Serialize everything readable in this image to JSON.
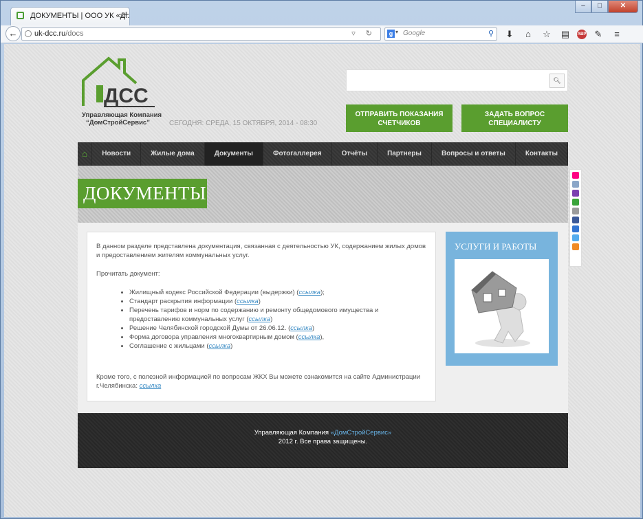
{
  "browser": {
    "tab_title": "ДОКУМЕНТЫ | ООО УК «Д...",
    "new_tab": "+",
    "url_host": "uk-dcc.ru",
    "url_path": "/docs",
    "search_engine": "g",
    "search_placeholder": "Google",
    "window_buttons": {
      "minimize": "–",
      "maximize": "□",
      "close": "✕"
    }
  },
  "header": {
    "logo_text": "ДСС",
    "logo_caption_1": "Управляющая Компания",
    "logo_caption_2": "“ДомСтройСервис”",
    "date_text": "СЕГОДНЯ: СРЕДА, 15 ОКТЯБРЯ, 2014 - 08:30",
    "search_value": "",
    "buttons": [
      {
        "label": "ОТПРАВИТЬ ПОКАЗАНИЯ СЧЕТЧИКОВ"
      },
      {
        "label": "ЗАДАТЬ ВОПРОС СПЕЦИАЛИСТУ"
      }
    ]
  },
  "menu": {
    "home_icon": "home-icon",
    "items": [
      {
        "label": "Новости"
      },
      {
        "label": "Жилые дома"
      },
      {
        "label": "Документы"
      },
      {
        "label": "Фотогаллерея"
      },
      {
        "label": "Отчёты"
      },
      {
        "label": "Партнеры"
      },
      {
        "label": "Вопросы и ответы"
      },
      {
        "label": "Контакты"
      }
    ],
    "active_index": 2
  },
  "page_title": "ДОКУМЕНТЫ",
  "content": {
    "intro": "В данном разделе представлена документация, связанная с деятельностью УК, содержанием жилых домов и предоставлением жителям коммунальных услуг.",
    "read_label": "Прочитать документ:",
    "link_text": "ссылка",
    "documents": [
      {
        "text": "Жилищный кодекс Российской Федерации (выдержки)",
        "link": "ссылка",
        "tail": ");"
      },
      {
        "text": "Стандарт раскрытия информации",
        "link": "ссылка",
        "tail": ")"
      },
      {
        "text": "Перечень тарифов и норм по содержанию и ремонту общедомового имущества и предоставлению коммунальных услуг",
        "link": "ссылка",
        "tail": ")"
      },
      {
        "text": "Решение Челябинской городской Думы от 26.06.12.",
        "link": "ссылка",
        "tail": ")"
      },
      {
        "text": "Форма договора управления многоквартирным домом",
        "link": "ссылка",
        "tail": "),"
      },
      {
        "text": "Соглашение с жильцами",
        "link": "ссылка",
        "tail": ")"
      }
    ],
    "outro": "Кроме того, с полезной информацией по вопросам ЖКХ Вы можете ознакомится на сайте Администрации г.Челябинска:",
    "outro_link": "ссылка"
  },
  "sidebar": {
    "title": "УСЛУГИ И РАБОТЫ"
  },
  "footer": {
    "line1_prefix": "Управляющая Компания ",
    "line1_brand": "«ДомСтройСервис»",
    "line2": "2012 г. Все права защищены."
  },
  "colors": {
    "accent_green": "#5a9e2f",
    "link_blue": "#3a8bc4",
    "sidebar_blue": "#78b4dd"
  },
  "social_icons": [
    "flickr-icon",
    "mail-icon",
    "yahoo-icon",
    "chat-icon",
    "grid-icon",
    "facebook-icon",
    "delicious-icon",
    "twitter-icon",
    "rss-icon"
  ]
}
